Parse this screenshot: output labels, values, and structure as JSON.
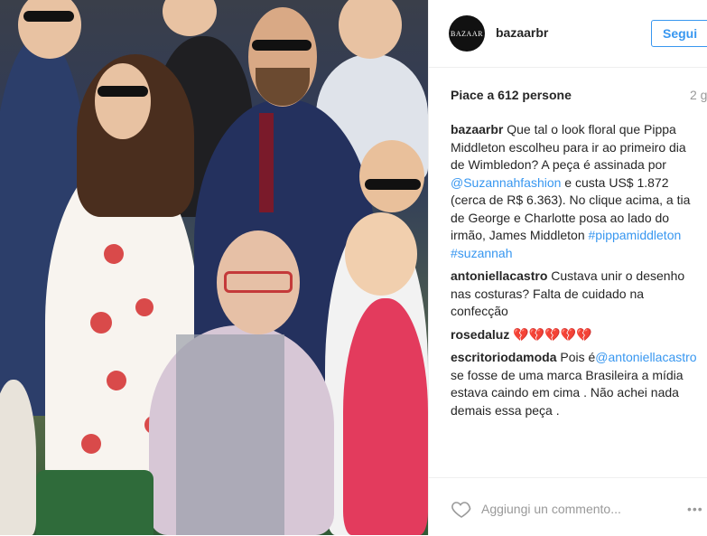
{
  "post": {
    "username": "bazaarbr",
    "avatar_text": "BAZAAR",
    "follow_label": "Segui",
    "likes_text": "Piace a 612 persone",
    "time_text": "2 g",
    "caption": {
      "user": "bazaarbr",
      "text_1": "Que tal o look floral que Pippa Middleton escolheu para ir ao primeiro dia de Wimbledon? A peça é assinada por ",
      "mention": "@Suzannahfashion",
      "text_2": " e custa US$ 1.872 (cerca de R$ 6.363). No clique acima, a tia de George e Charlotte posa ao lado do irmão, James Middleton ",
      "hashtag_1": "#pippamiddleton",
      "hashtag_2": "#suzannah"
    },
    "comments": [
      {
        "user": "antoniellacastro",
        "text": "Custava unir o desenho nas costuras? Falta de cuidado na confecção"
      },
      {
        "user": "rosedaluz",
        "text": "💔💔💔💔💔"
      },
      {
        "user": "escritoriodamoda",
        "text_1": "Pois é",
        "mention": "@antoniellacastro",
        "text_2": " se fosse de uma marca Brasileira a mídia estava caindo em cima . Não achei nada demais essa peça ."
      }
    ],
    "add_comment_placeholder": "Aggiungi un commento...",
    "more_label": "•••"
  },
  "icons": {
    "heart": "heart-icon",
    "more": "more-options-icon"
  }
}
